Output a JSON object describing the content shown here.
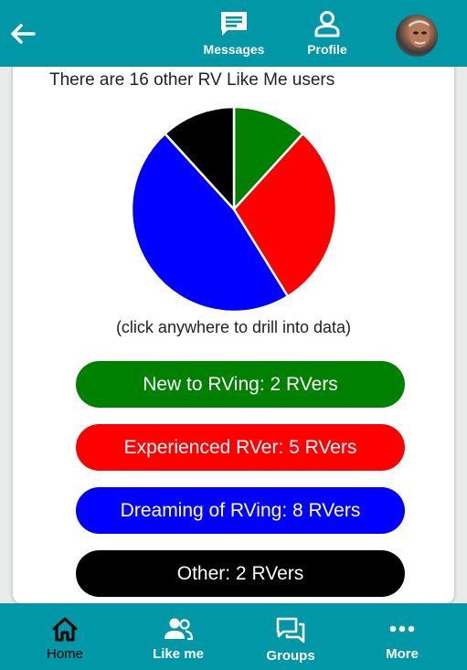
{
  "header": {
    "messages_label": "Messages",
    "profile_label": "Profile"
  },
  "main": {
    "headline": "There are 16 other RV Like Me users",
    "hint": "(click anywhere to drill into data)"
  },
  "chart_data": {
    "type": "pie",
    "categories": [
      "New to RVing",
      "Experienced RVer",
      "Dreaming of RVing",
      "Other"
    ],
    "values": [
      2,
      5,
      8,
      2
    ],
    "colors": [
      "#008000",
      "#ff0000",
      "#0000ff",
      "#000000"
    ]
  },
  "buttons": [
    {
      "label": "New to RVing: 2 RVers",
      "color": "#008000"
    },
    {
      "label": "Experienced RVer: 5 RVers",
      "color": "#ff0000"
    },
    {
      "label": "Dreaming of RVing: 8 RVers",
      "color": "#0000ff"
    },
    {
      "label": "Other: 2 RVers",
      "color": "#000000"
    }
  ],
  "bottom_nav": {
    "home_label": "Home",
    "likeme_label": "Like me",
    "groups_label": "Groups",
    "more_label": "More"
  },
  "colors": {
    "bar": "#0097a7",
    "active_nav": "#000000"
  }
}
